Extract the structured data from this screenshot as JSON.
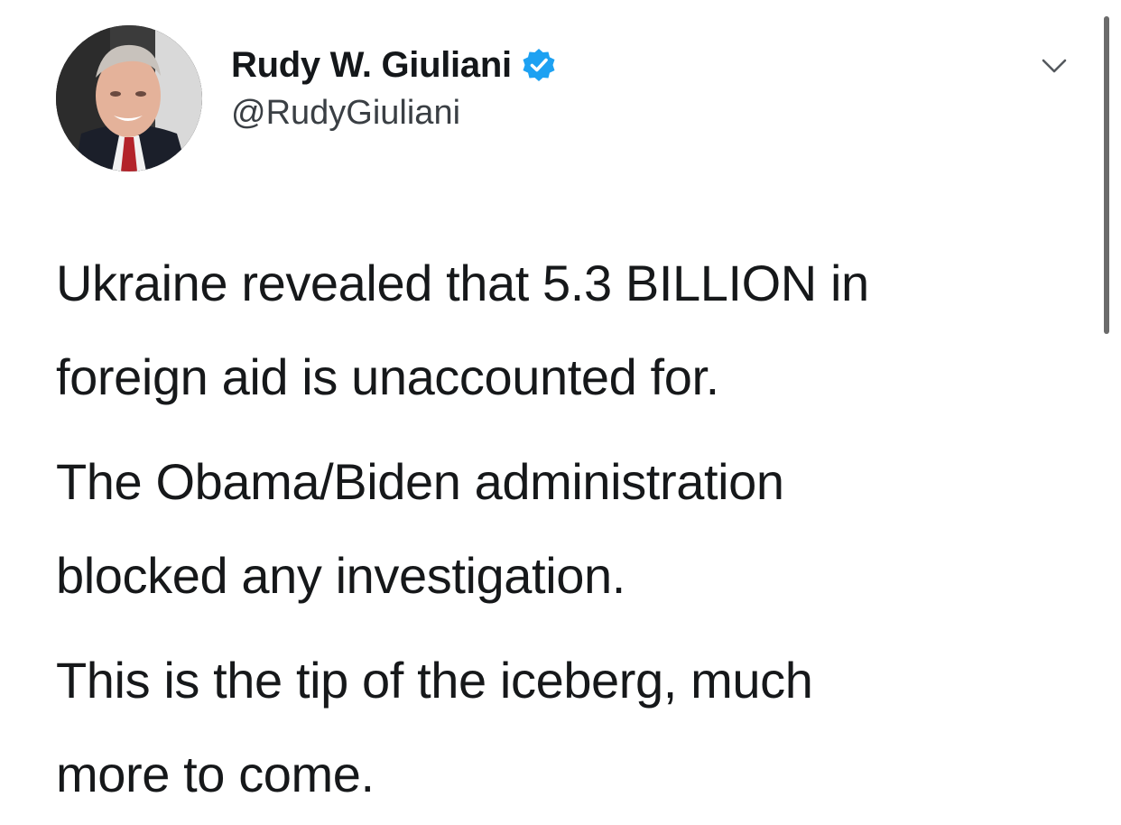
{
  "author": {
    "display_name": "Rudy W. Giuliani",
    "handle": "@RudyGiuliani",
    "verified": true
  },
  "icons": {
    "verified": "verified-badge-icon",
    "menu": "chevron-down-icon"
  },
  "tweet": {
    "paragraphs": [
      {
        "line1": "Ukraine revealed that 5.3 BILLION in",
        "line2": "foreign aid is unaccounted for."
      },
      {
        "line1": "The Obama/Biden administration",
        "line2": "blocked any investigation."
      },
      {
        "line1": "This is the tip of the iceberg, much",
        "line2": "more to come."
      }
    ]
  },
  "colors": {
    "verified_blue": "#1da1f2",
    "text": "#14171a",
    "handle": "#3a3f44"
  }
}
